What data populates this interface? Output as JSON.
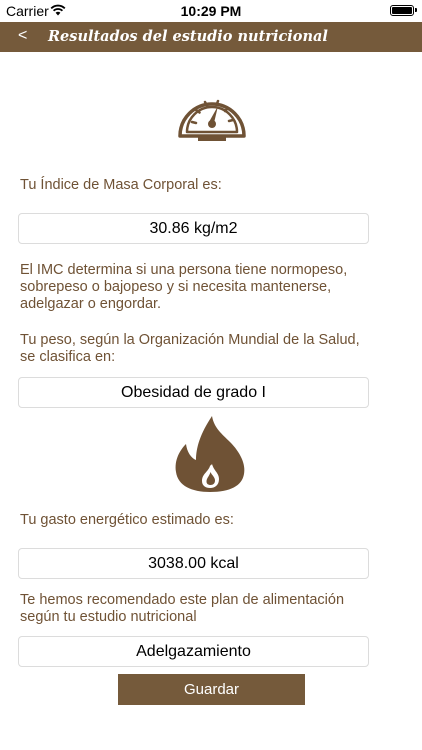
{
  "status_bar": {
    "carrier": "Carrier",
    "time": "10:29 PM"
  },
  "navbar": {
    "back_label": "<",
    "title": "Resultados del estudio nutricional",
    "background": "#755a3b"
  },
  "icons": {
    "gauge": "speedometer-icon",
    "flame": "flame-icon"
  },
  "imc": {
    "label": "Tu Índice de Masa Corporal es:",
    "value": "30.86 kg/m2",
    "description": "El IMC determina si una persona tiene normopeso, sobrepeso o bajopeso y si necesita mantenerse, adelgazar o engordar."
  },
  "classification": {
    "label": "Tu peso, según la Organización Mundial de la Salud, se clasifica en:",
    "value": "Obesidad de grado I"
  },
  "energy": {
    "label": "Tu gasto energético estimado es:",
    "value": "3038.00 kcal"
  },
  "plan": {
    "label": "Te hemos recomendado este plan de alimentación según tu estudio nutricional",
    "value": "Adelgazamiento"
  },
  "actions": {
    "save_label": "Guardar"
  },
  "colors": {
    "accent": "#755a3b",
    "text": "#6f5235"
  }
}
